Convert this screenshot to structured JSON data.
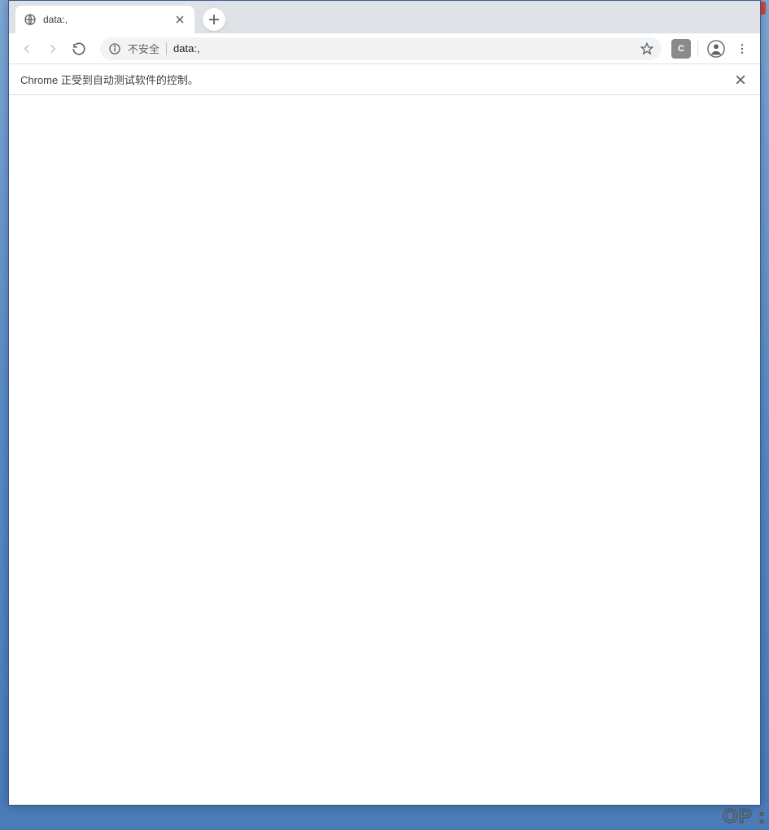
{
  "tabs": {
    "active": {
      "title": "data:,"
    }
  },
  "omnibox": {
    "security_label": "不安全",
    "url": "data:,"
  },
  "extension": {
    "badge": "C"
  },
  "info_bar": {
    "message": "Chrome 正受到自动测试软件的控制。"
  },
  "watermark": "OP :"
}
